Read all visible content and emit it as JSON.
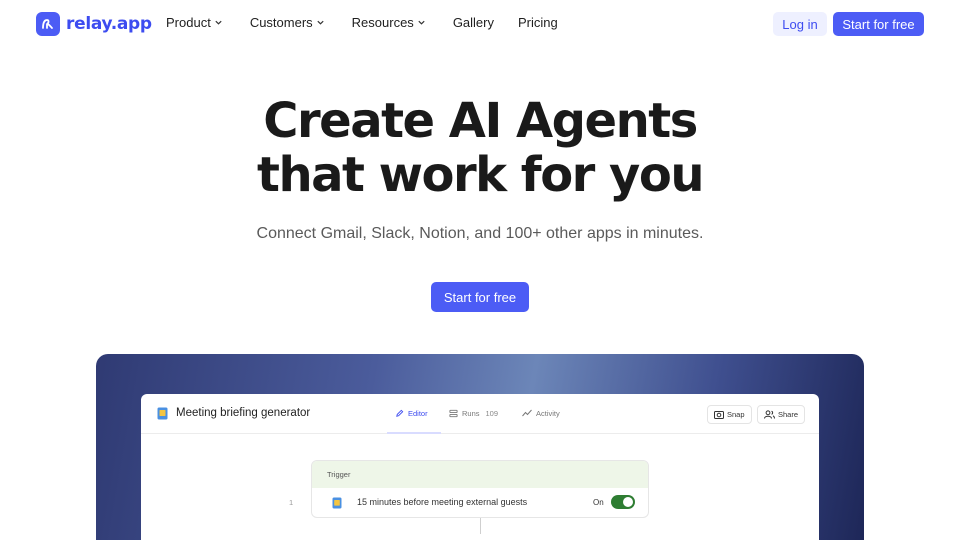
{
  "brand": {
    "name": "relay.app",
    "accent": "#4c5cf5"
  },
  "nav": {
    "items": [
      {
        "label": "Product",
        "has_menu": true
      },
      {
        "label": "Customers",
        "has_menu": true
      },
      {
        "label": "Resources",
        "has_menu": true
      },
      {
        "label": "Gallery",
        "has_menu": false
      },
      {
        "label": "Pricing",
        "has_menu": false
      }
    ],
    "login_label": "Log in",
    "start_label": "Start for free"
  },
  "hero": {
    "title_line1": "Create AI Agents",
    "title_line2": "that work for you",
    "subtitle": "Connect Gmail, Slack, Notion, and 100+ other apps in minutes.",
    "cta_label": "Start for free"
  },
  "preview": {
    "workflow_title": "Meeting briefing generator",
    "tabs": [
      {
        "label": "Editor",
        "icon": "pencil-icon",
        "active": true
      },
      {
        "label": "Runs",
        "icon": "list-icon",
        "count": "109"
      },
      {
        "label": "Activity",
        "icon": "activity-icon"
      }
    ],
    "snap_label": "Snap",
    "share_label": "Share",
    "trigger": {
      "header": "Trigger",
      "step_number": "1",
      "text": "15 minutes before meeting external guests",
      "toggle_label": "On",
      "toggle_on": true
    }
  }
}
